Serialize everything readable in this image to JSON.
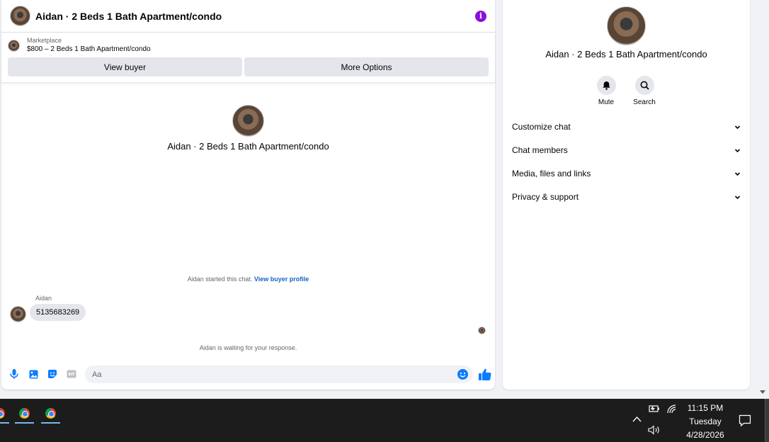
{
  "chat": {
    "title": "Aidan · 2 Beds 1 Bath Apartment/condo",
    "info_icon_label": "i",
    "listing": {
      "kicker": "Marketplace",
      "summary": "$800 – 2 Beds 1 Bath Apartment/condo",
      "view_buyer_label": "View buyer",
      "more_options_label": "More Options"
    },
    "profile_name": "Aidan · 2 Beds 1 Bath Apartment/condo",
    "started_text": "Aidan started this chat.",
    "view_profile_link": "View buyer profile",
    "sender": "Aidan",
    "message": "5135683269",
    "waiting_text": "Aidan is waiting for your response.",
    "input_placeholder": "Aa"
  },
  "details": {
    "name": "Aidan · 2 Beds 1 Bath Apartment/condo",
    "actions": [
      {
        "label": "Mute",
        "icon": "bell-icon"
      },
      {
        "label": "Search",
        "icon": "search-icon"
      }
    ],
    "sections": [
      {
        "label": "Customize chat"
      },
      {
        "label": "Chat members"
      },
      {
        "label": "Media, files and links"
      },
      {
        "label": "Privacy & support"
      }
    ]
  },
  "taskbar": {
    "apps": [
      "chrome-icon",
      "chrome-icon",
      "chrome-icon"
    ],
    "time": "11:15 PM",
    "day": "Tuesday",
    "date": "4/28/2026"
  },
  "colors": {
    "accent": "#0a7cff",
    "info": "#8a0fd8",
    "link": "#1565c0",
    "taskbar": "#1c1c1c"
  }
}
